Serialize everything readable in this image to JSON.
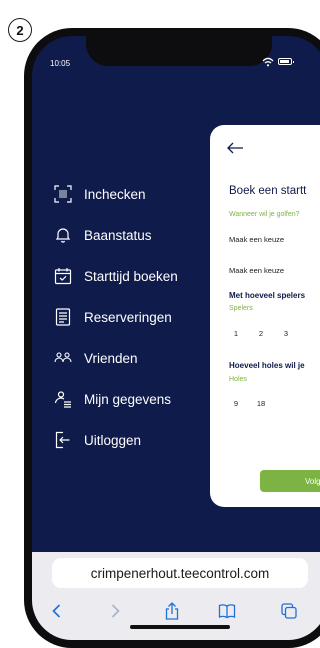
{
  "step": "2",
  "status_bar": {
    "time": "10:05"
  },
  "menu": {
    "items": [
      {
        "id": "inchecken",
        "label": "Inchecken",
        "icon": "qr-scan-icon"
      },
      {
        "id": "baanstatus",
        "label": "Baanstatus",
        "icon": "bell-icon"
      },
      {
        "id": "starttijd",
        "label": "Starttijd boeken",
        "icon": "calendar-check-icon"
      },
      {
        "id": "reserveringen",
        "label": "Reserveringen",
        "icon": "document-list-icon"
      },
      {
        "id": "vrienden",
        "label": "Vrienden",
        "icon": "friends-icon"
      },
      {
        "id": "gegevens",
        "label": "Mijn gegevens",
        "icon": "user-details-icon"
      },
      {
        "id": "uitloggen",
        "label": "Uitloggen",
        "icon": "logout-icon"
      }
    ]
  },
  "panel": {
    "title": "Boek een startt",
    "when_label": "Wanneer wil je golfen?",
    "select1": "Maak een keuze",
    "select2": "Maak een keuze",
    "players_heading": "Met hoeveel spelers",
    "players_label": "Spelers",
    "players": [
      "1",
      "2",
      "3"
    ],
    "holes_heading": "Hoeveel holes wil je",
    "holes_label": "Holes",
    "holes": [
      "9",
      "18"
    ],
    "next_button": "Volge"
  },
  "browser": {
    "url": "crimpenerhout.teecontrol.com"
  },
  "colors": {
    "navy": "#0f1b4a",
    "green": "#7cb342",
    "browser_blue": "#1e6fd9"
  }
}
